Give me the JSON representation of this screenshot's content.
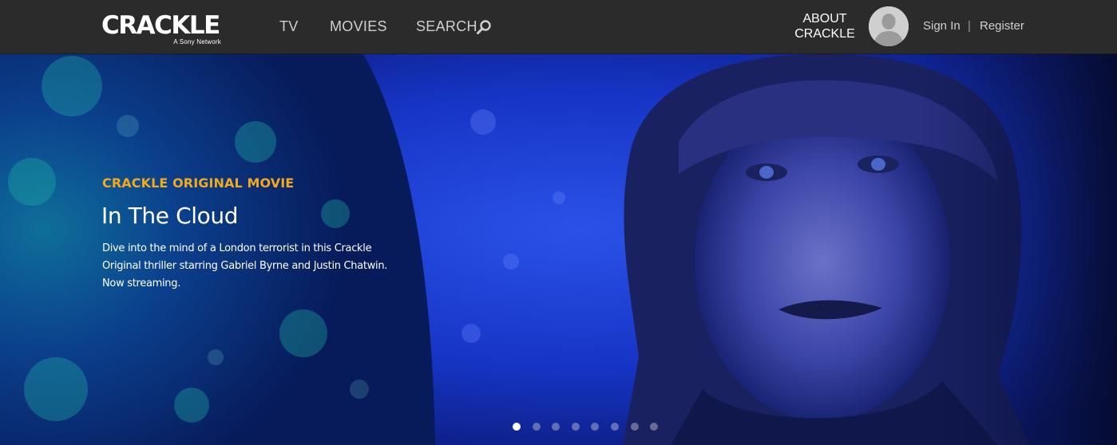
{
  "header": {
    "logo_text": "CRACKLE",
    "logo_subtext": "A Sony Network",
    "nav": [
      {
        "label": "TV"
      },
      {
        "label": "MOVIES"
      },
      {
        "label": "SEARCH",
        "icon": "search-icon"
      }
    ],
    "about_line1": "ABOUT",
    "about_line2": "CRACKLE",
    "avatar_icon": "user-avatar-icon",
    "sign_in": "Sign In",
    "separator": "|",
    "register": "Register"
  },
  "hero": {
    "eyebrow": "CRACKLE ORIGINAL MOVIE",
    "title": "In The Cloud",
    "description": "Dive into the mind of a London terrorist in this Crackle Original thriller starring Gabriel Byrne and Justin Chatwin. Now streaming.",
    "carousel": {
      "total_slides": 8,
      "active_index": 0
    }
  },
  "colors": {
    "header_bg": "#2b2b2b",
    "accent": "#f4a81c",
    "hero_blue": "#1e3ad8"
  }
}
